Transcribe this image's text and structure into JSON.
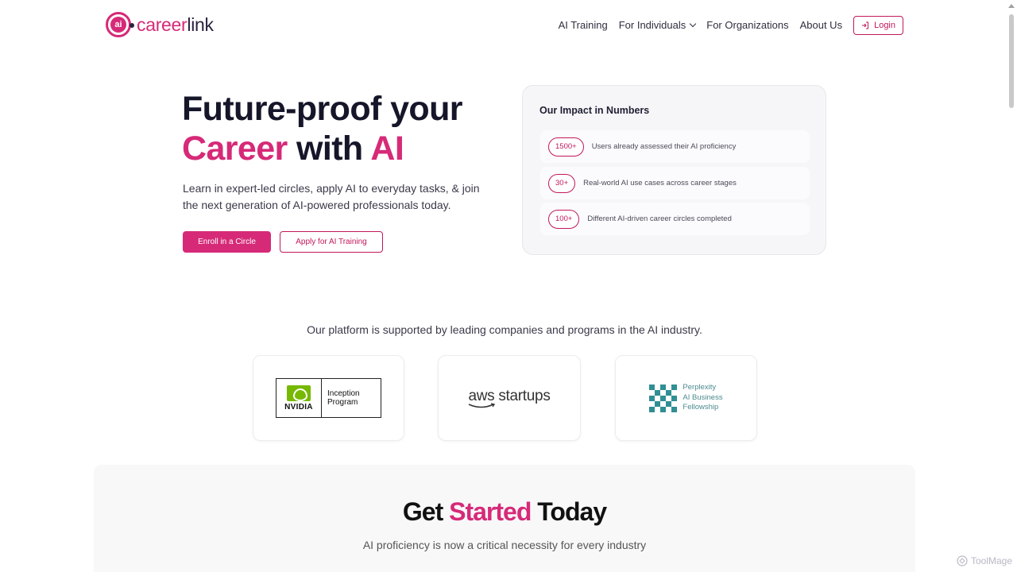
{
  "brand": {
    "logo_mark": "ai",
    "name_part1": "career",
    "name_part2": "link",
    "primary_color": "#d62a78",
    "dark_color": "#2a2140"
  },
  "nav": {
    "items": [
      {
        "label": "AI Training"
      },
      {
        "label": "For Individuals"
      },
      {
        "label": "For Organizations"
      },
      {
        "label": "About Us"
      }
    ],
    "login_label": "Login",
    "login_icon": "login-arrow-icon",
    "dropdown_icon": "chevron-down-icon"
  },
  "hero": {
    "title_line1": "Future-proof your",
    "title_highlight1": "Career",
    "title_mid": " with ",
    "title_highlight2": "AI",
    "subtitle": "Learn in expert-led circles, apply AI to everyday tasks, & join the next generation of AI-powered professionals today.",
    "primary_cta": "Enroll in a Circle",
    "secondary_cta": "Apply for AI Training"
  },
  "impact": {
    "title": "Our Impact in Numbers",
    "items": [
      {
        "badge": "1500+",
        "text": "Users already assessed their AI proficiency"
      },
      {
        "badge": "30+",
        "text": "Real-world AI use cases across career stages"
      },
      {
        "badge": "100+",
        "text": "Different AI-driven career circles completed"
      }
    ]
  },
  "partners": {
    "title": "Our platform is supported by leading companies and programs in the AI industry.",
    "nvidia": {
      "word": "NVIDIA",
      "line1": "Inception",
      "line2": "Program"
    },
    "aws": {
      "text": "aws startups"
    },
    "perplexity": {
      "line1": "Perplexity",
      "line2": "AI Business",
      "line3": "Fellowship",
      "color": "#2f8f94"
    }
  },
  "get_started": {
    "title_part1": "Get ",
    "title_highlight": "Started",
    "title_part2": " Today",
    "subtitle": "AI proficiency is now a critical necessity for every industry"
  },
  "watermark": {
    "text": "ToolMage"
  }
}
